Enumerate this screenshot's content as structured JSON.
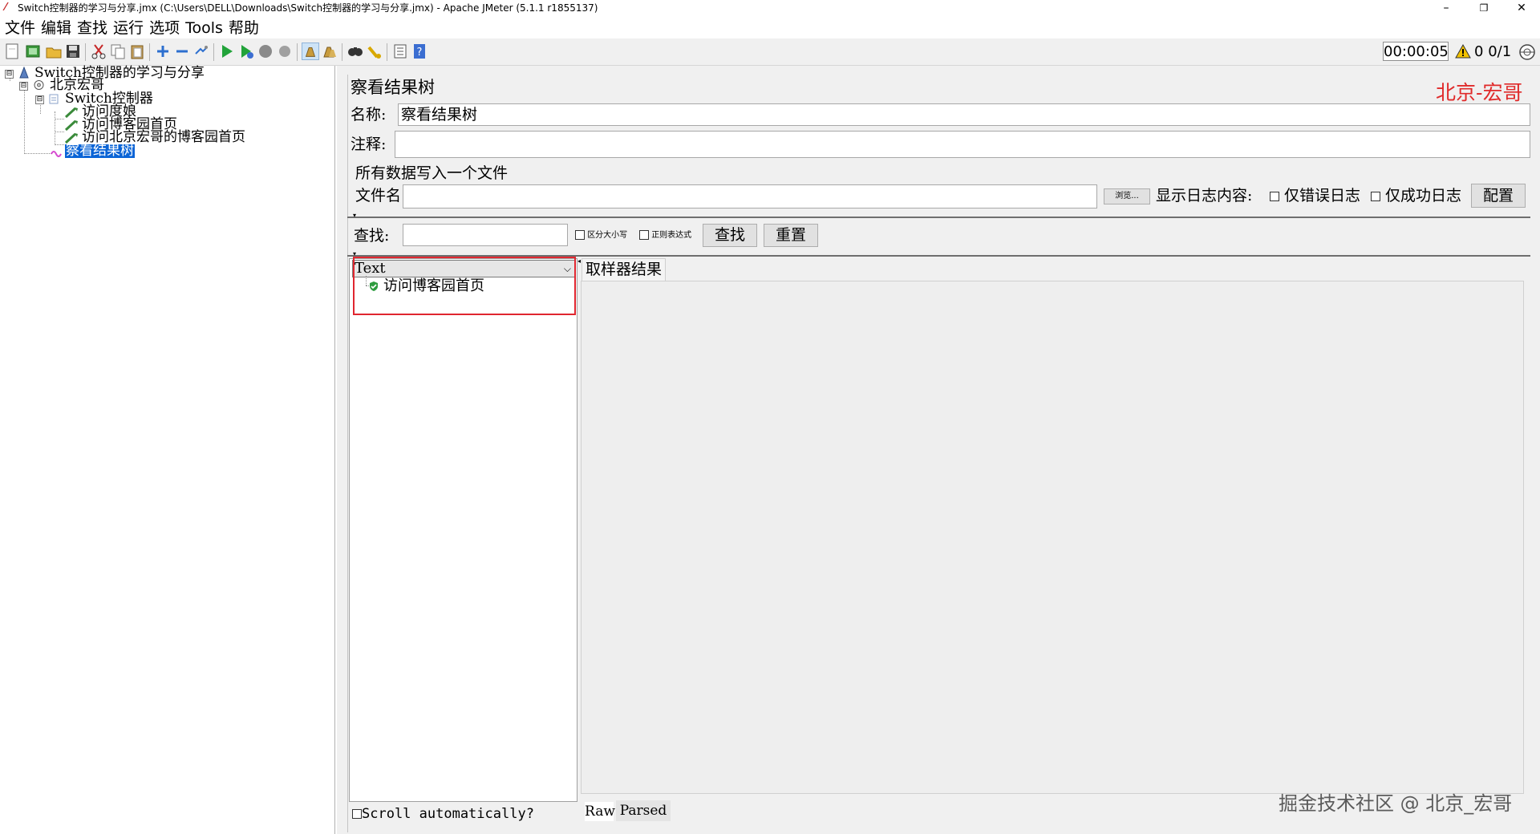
{
  "window": {
    "title": "Switch控制器的学习与分享.jmx (C:\\Users\\DELL\\Downloads\\Switch控制器的学习与分享.jmx) - Apache JMeter (5.1.1 r1855137)",
    "minimize": "–",
    "restore": "❐",
    "close": "✕"
  },
  "menu": [
    "文件",
    "编辑",
    "查找",
    "运行",
    "选项",
    "Tools",
    "帮助"
  ],
  "toolbar": {
    "icons": [
      "new-icon",
      "templates-icon",
      "open-icon",
      "save-icon",
      "cut-icon",
      "copy-icon",
      "paste-icon",
      "expand-icon",
      "collapse-icon",
      "toggle-icon",
      "start-icon",
      "start-no-pause-icon",
      "stop-icon",
      "shutdown-icon",
      "clear-icon",
      "clear-all-icon",
      "search-icon",
      "reset-search-icon",
      "function-helper-icon",
      "help-icon"
    ],
    "timer": "00:00:05",
    "warning_count": "0",
    "threads": "0/1"
  },
  "tree": {
    "nodes": [
      {
        "label": "Switch控制器的学习与分享",
        "icon": "testplan-icon",
        "level": 0,
        "expander": "⊟"
      },
      {
        "label": "北京宏哥",
        "icon": "threadgroup-icon",
        "level": 1,
        "expander": "⊟"
      },
      {
        "label": "Switch控制器",
        "icon": "switch-controller-icon",
        "level": 2,
        "expander": "⊟"
      },
      {
        "label": "访问度娘",
        "icon": "sampler-icon",
        "level": 3
      },
      {
        "label": "访问博客园首页",
        "icon": "sampler-icon",
        "level": 3
      },
      {
        "label": "访问北京宏哥的博客园首页",
        "icon": "sampler-icon",
        "level": 3
      },
      {
        "label": "察看结果树",
        "icon": "listener-icon",
        "level": 1,
        "selected": true
      }
    ]
  },
  "panel": {
    "header": "察看结果树",
    "watermark": "北京-宏哥",
    "name_label": "名称:",
    "name_value": "察看结果树",
    "comment_label": "注释:",
    "comment_value": "",
    "file_section_title": "所有数据写入一个文件",
    "filename_label": "文件名",
    "filename_value": "",
    "browse_label": "浏览...",
    "log_label": "显示日志内容:",
    "errors_only_label": "仅错误日志",
    "success_only_label": "仅成功日志",
    "configure_label": "配置",
    "search_label": "查找:",
    "search_value": "",
    "case_sensitive_label": "区分大小写",
    "regex_label": "正则表达式",
    "find_button": "查找",
    "reset_button": "重置",
    "renderer_selected": "Text",
    "result_item": "访问博客园首页",
    "tab_sampler_result": "取样器结果",
    "scroll_auto_label": "Scroll automatically?",
    "tab_raw": "Raw",
    "tab_parsed": "Parsed",
    "footer_watermark": "掘金技术社区 @ 北京_宏哥"
  }
}
